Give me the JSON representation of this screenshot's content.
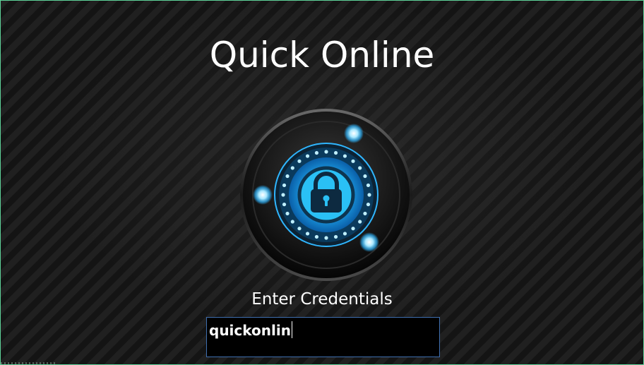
{
  "app": {
    "title": "Quick Online"
  },
  "login": {
    "prompt": "Enter Credentials",
    "credentials_value": "quickonlin",
    "lock_icon": "padlock-icon"
  },
  "colors": {
    "background": "#1b1b1b",
    "glow": "#2fb6ff",
    "input_border": "#3f6fb0",
    "text": "#ffffff"
  }
}
